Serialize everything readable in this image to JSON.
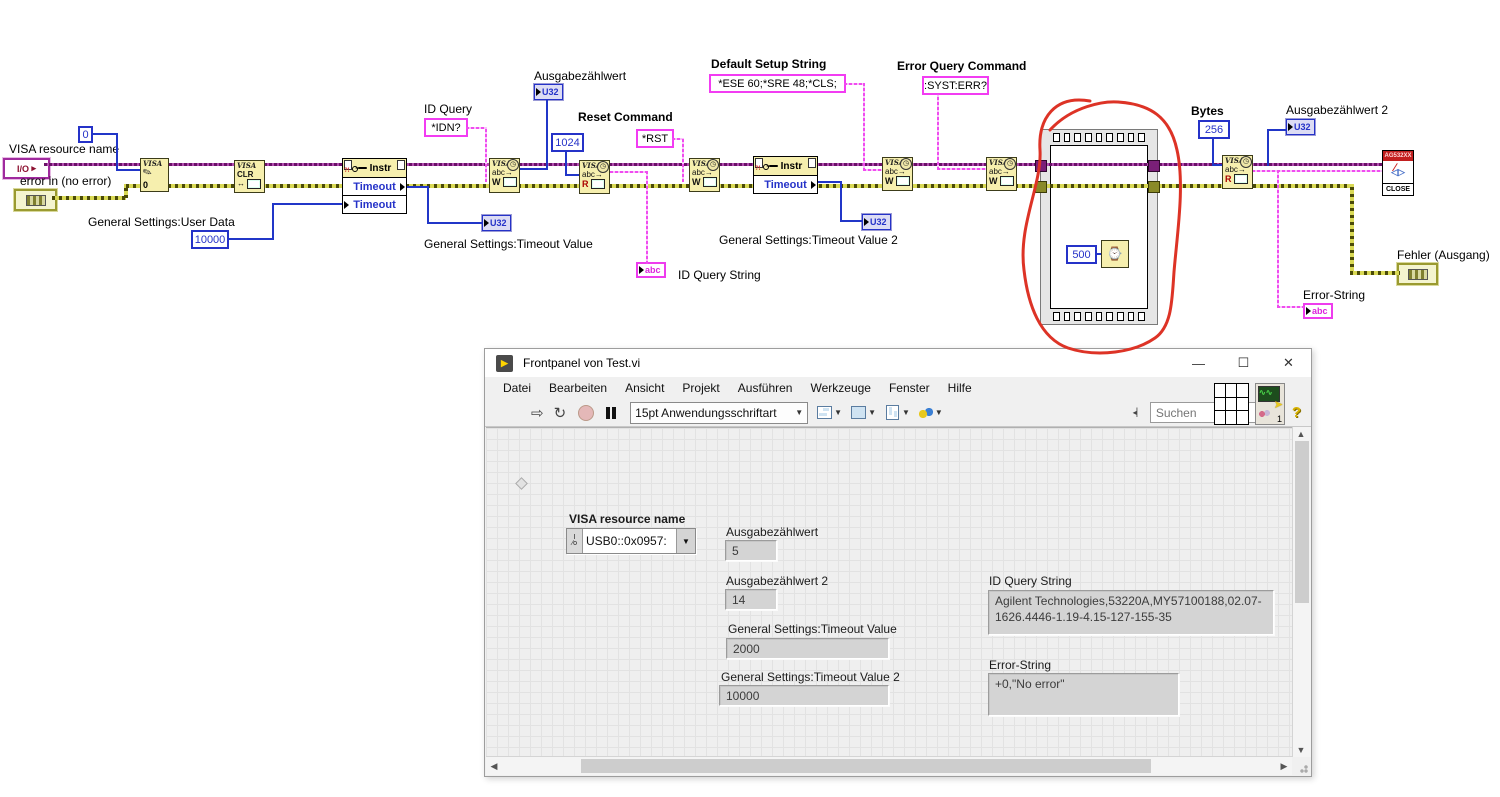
{
  "diagram": {
    "labels": {
      "visa_resource_name": "VISA resource name",
      "error_in": "error in (no error)",
      "user_data": "General Settings:User Data",
      "id_query": "ID Query",
      "ausgabe1": "Ausgabezählwert",
      "reset_command": "Reset Command",
      "timeout_value": "General Settings:Timeout Value",
      "id_query_string": "ID Query String",
      "default_setup": "Default Setup String",
      "timeout_value2": "General Settings:Timeout Value 2",
      "error_query": "Error Query Command",
      "bytes": "Bytes",
      "ausgabe2": "Ausgabezählwert 2",
      "fehler_ausgang": "Fehler (Ausgang)",
      "error_string": "Error-String"
    },
    "constants": {
      "init": "0",
      "user_data": "10000",
      "idn": "*IDN?",
      "read_bytes": "1024",
      "rst": "*RST",
      "setup": "*ESE 60;*SRE 48;*CLS;",
      "err_query": ":SYST:ERR?",
      "wait_ms": "500",
      "bytes": "256"
    },
    "node_text": {
      "visa": "VISA",
      "clr": "CLR",
      "instr": "Instr",
      "timeout": "Timeout",
      "w": "W",
      "r": "R",
      "abc": "abc",
      "abc_arrow": "abc→",
      "u32": "U32",
      "io": "I/O",
      "open_mode": "0",
      "close_banner": "AG532XX",
      "close": "CLOSE",
      "clock": "◷",
      "watch": "⌚"
    }
  },
  "window": {
    "title": "Frontpanel von Test.vi",
    "menus": [
      "Datei",
      "Bearbeiten",
      "Ansicht",
      "Projekt",
      "Ausführen",
      "Werkzeuge",
      "Fenster",
      "Hilfe"
    ],
    "toolbar": {
      "font": "15pt Anwendungsschriftart",
      "search_placeholder": "Suchen",
      "vi_number": "1"
    },
    "panel": {
      "visa_resource": {
        "label": "VISA resource name",
        "value": "USB0::0x0957:"
      },
      "ausgabe1": {
        "label": "Ausgabezählwert",
        "value": "5"
      },
      "ausgabe2": {
        "label": "Ausgabezählwert 2",
        "value": "14"
      },
      "timeout1": {
        "label": "General Settings:Timeout Value",
        "value": "2000"
      },
      "timeout2": {
        "label": "General Settings:Timeout Value 2",
        "value": "10000"
      },
      "id_query_string": {
        "label": "ID Query String",
        "value": "Agilent Technologies,53220A,MY57100188,02.07-1626.4446-1.19-4.15-127-155-35"
      },
      "error_string": {
        "label": "Error-String",
        "value": "+0,\"No error\""
      }
    }
  }
}
